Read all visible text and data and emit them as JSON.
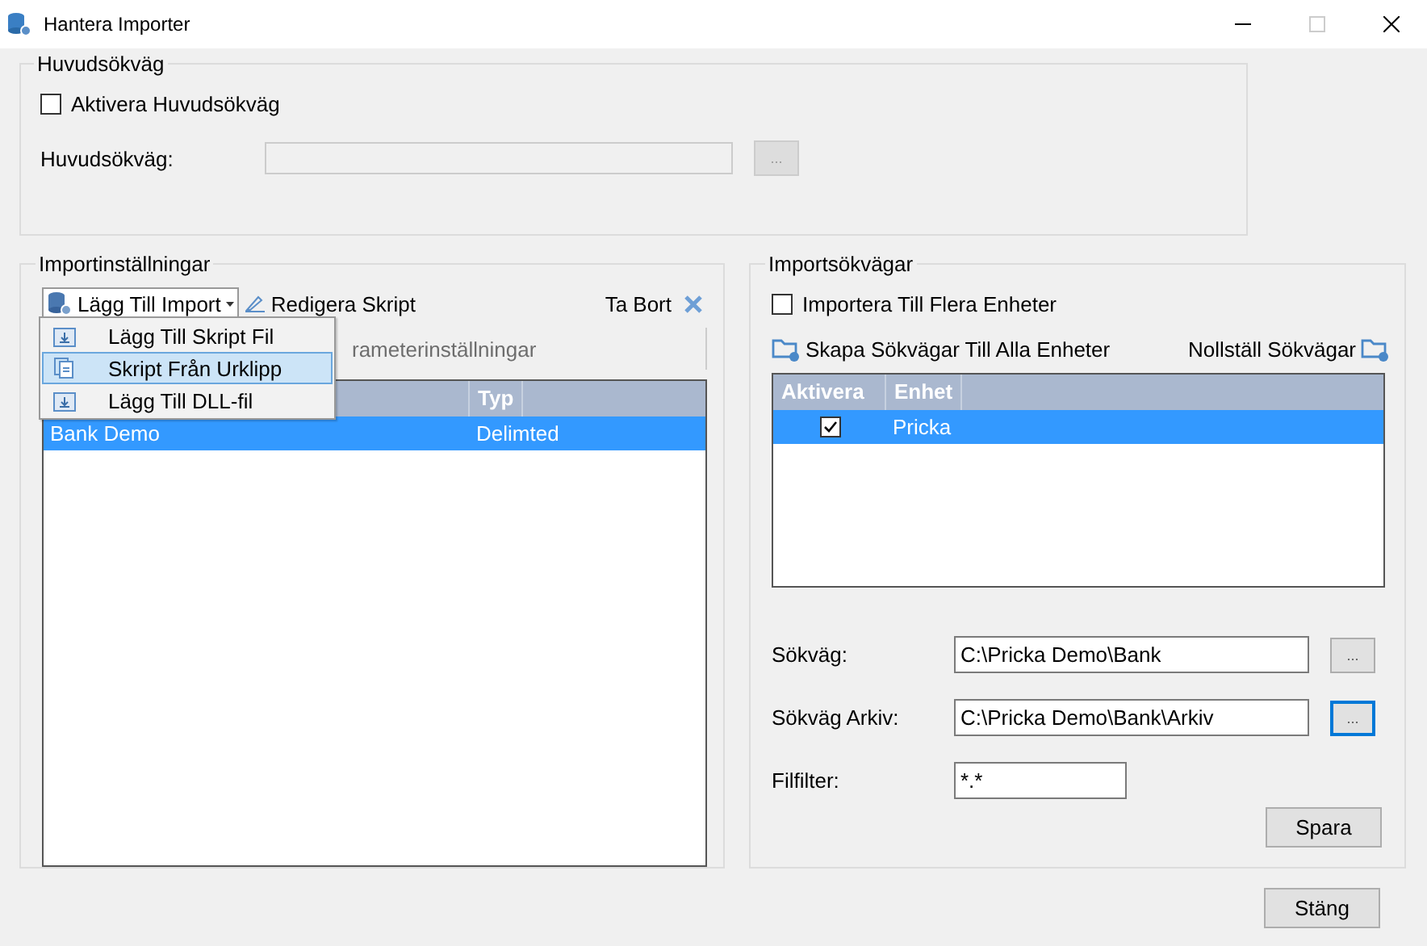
{
  "window": {
    "title": "Hantera Importer"
  },
  "main_path": {
    "title": "Huvudsökväg",
    "enable": {
      "label": "Aktivera Huvudsökväg",
      "checked": false
    },
    "path_label": "Huvudsökväg:",
    "disabled": true,
    "browse": "..."
  },
  "import_settings": {
    "title": "Importinställningar",
    "toolbar": [
      {
        "label": "Lägg Till Import",
        "kind": "dropdown",
        "expanded": true
      },
      {
        "label": "Redigera Skript",
        "kind": "button"
      }
    ],
    "delete_button": "Ta Bort",
    "menu": [
      {
        "label": "Lägg Till Skript Fil",
        "selected": false
      },
      {
        "label": "Skript Från Urklipp",
        "selected": true
      },
      {
        "label": "Lägg Till DLL-fil",
        "selected": false
      }
    ],
    "second_toolbar_text": "rameterinställningar",
    "table": {
      "column_2": "Typ",
      "rows": [
        {
          "cells": [
            "Bank Demo",
            "Delimted"
          ],
          "selected": true
        }
      ]
    }
  },
  "import_paths": {
    "title": "Importsökvägar",
    "multi": {
      "label": "Importera Till Flera Enheter",
      "checked": false
    },
    "create_button": "Skapa Sökvägar Till Alla Enheter",
    "reset_button": "Nollställ Sökvägar",
    "grid": {
      "columns": [
        "Aktivera",
        "Enhet"
      ],
      "rows": [
        {
          "active": true,
          "unit": "Pricka",
          "selected": true
        }
      ]
    },
    "fields": [
      {
        "label": "Sökväg:",
        "value": "C:\\Pricka Demo\\Bank",
        "kind": "path",
        "browse": "...",
        "focused": false
      },
      {
        "label": "Sökväg Arkiv:",
        "value": "C:\\Pricka Demo\\Bank\\Arkiv",
        "kind": "path",
        "browse": "...",
        "focused": true
      },
      {
        "label": "Filfilter:",
        "value": "*.*",
        "kind": "filter"
      }
    ],
    "save_button": "Spara"
  },
  "close_button": "Stäng"
}
